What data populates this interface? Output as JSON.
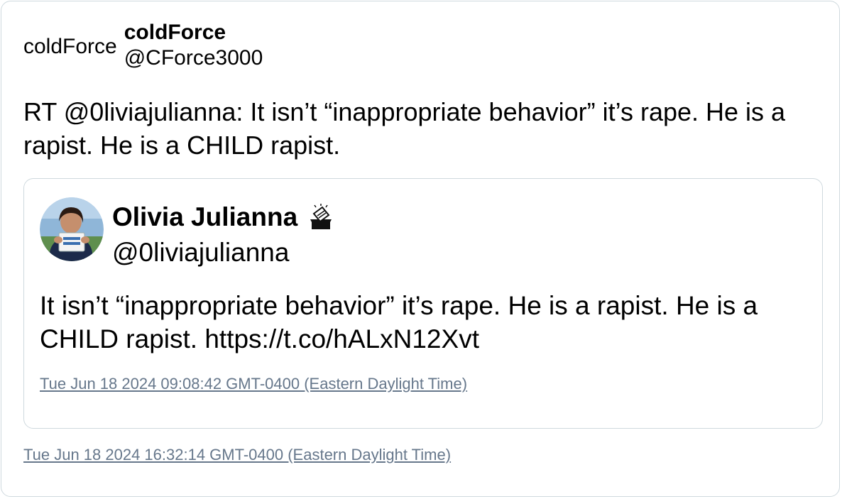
{
  "tweet": {
    "author": {
      "avatar_alt": "coldForce",
      "display_name": "coldForce",
      "handle": "@CForce3000"
    },
    "text": "RT @0liviajulianna: It isn’t “inappropriate behavior” it’s rape. He is a rapist. He is a CHILD rapist.",
    "timestamp": "Tue Jun 18 2024 16:32:14 GMT-0400 (Eastern Daylight Time)"
  },
  "quoted_tweet": {
    "author": {
      "display_name": "Olivia Julianna",
      "name_badge_icon": "ballot-box-icon",
      "handle": "@0liviajulianna"
    },
    "text": "It isn’t “inappropriate behavior” it’s rape. He is a rapist. He is a CHILD rapist. https://t.co/hALxN12Xvt",
    "timestamp": "Tue Jun 18 2024 09:08:42 GMT-0400 (Eastern Daylight Time)"
  },
  "colors": {
    "border": "#cfd9de",
    "timestamp_link": "#66778b"
  }
}
